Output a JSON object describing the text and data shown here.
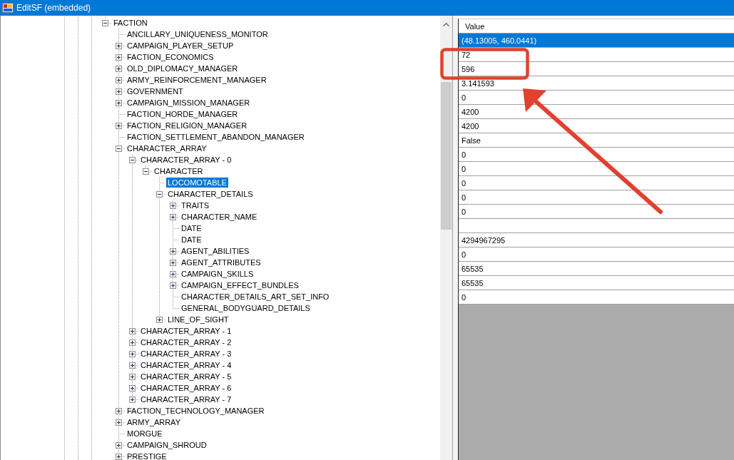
{
  "window": {
    "title": "EditSF (embedded)"
  },
  "tree": {
    "nodes": [
      {
        "label": "FACTION",
        "expanded": true,
        "selected": false,
        "children": [
          {
            "label": "ANCILLARY_UNIQUENESS_MONITOR",
            "selected": false
          },
          {
            "label": "CAMPAIGN_PLAYER_SETUP",
            "expanded": false,
            "selected": false
          },
          {
            "label": "FACTION_ECONOMICS",
            "expanded": false,
            "selected": false
          },
          {
            "label": "OLD_DIPLOMACY_MANAGER",
            "expanded": false,
            "selected": false
          },
          {
            "label": "ARMY_REINFORCEMENT_MANAGER",
            "expanded": false,
            "selected": false
          },
          {
            "label": "GOVERNMENT",
            "expanded": false,
            "selected": false
          },
          {
            "label": "CAMPAIGN_MISSION_MANAGER",
            "expanded": false,
            "selected": false
          },
          {
            "label": "FACTION_HORDE_MANAGER",
            "selected": false
          },
          {
            "label": "FACTION_RELIGION_MANAGER",
            "expanded": false,
            "selected": false
          },
          {
            "label": "FACTION_SETTLEMENT_ABANDON_MANAGER",
            "selected": false
          },
          {
            "label": "CHARACTER_ARRAY",
            "expanded": true,
            "selected": false,
            "children": [
              {
                "label": "CHARACTER_ARRAY - 0",
                "expanded": true,
                "selected": false,
                "children": [
                  {
                    "label": "CHARACTER",
                    "expanded": true,
                    "selected": false,
                    "children": [
                      {
                        "label": "LOCOMOTABLE",
                        "selected": true
                      },
                      {
                        "label": "CHARACTER_DETAILS",
                        "expanded": true,
                        "selected": false,
                        "children": [
                          {
                            "label": "TRAITS",
                            "expanded": false,
                            "selected": false
                          },
                          {
                            "label": "CHARACTER_NAME",
                            "expanded": false,
                            "selected": false
                          },
                          {
                            "label": "DATE",
                            "selected": false
                          },
                          {
                            "label": "DATE",
                            "selected": false
                          },
                          {
                            "label": "AGENT_ABILITIES",
                            "expanded": false,
                            "selected": false
                          },
                          {
                            "label": "AGENT_ATTRIBUTES",
                            "expanded": false,
                            "selected": false
                          },
                          {
                            "label": "CAMPAIGN_SKILLS",
                            "expanded": false,
                            "selected": false
                          },
                          {
                            "label": "CAMPAIGN_EFFECT_BUNDLES",
                            "expanded": false,
                            "selected": false
                          },
                          {
                            "label": "CHARACTER_DETAILS_ART_SET_INFO",
                            "selected": false
                          },
                          {
                            "label": "GENERAL_BODYGUARD_DETAILS",
                            "selected": false
                          }
                        ]
                      },
                      {
                        "label": "LINE_OF_SIGHT",
                        "expanded": false,
                        "selected": false
                      }
                    ]
                  }
                ]
              },
              {
                "label": "CHARACTER_ARRAY - 1",
                "expanded": false,
                "selected": false
              },
              {
                "label": "CHARACTER_ARRAY - 2",
                "expanded": false,
                "selected": false
              },
              {
                "label": "CHARACTER_ARRAY - 3",
                "expanded": false,
                "selected": false
              },
              {
                "label": "CHARACTER_ARRAY - 4",
                "expanded": false,
                "selected": false
              },
              {
                "label": "CHARACTER_ARRAY - 5",
                "expanded": false,
                "selected": false
              },
              {
                "label": "CHARACTER_ARRAY - 6",
                "expanded": false,
                "selected": false
              },
              {
                "label": "CHARACTER_ARRAY - 7",
                "expanded": false,
                "selected": false
              }
            ]
          },
          {
            "label": "FACTION_TECHNOLOGY_MANAGER",
            "expanded": false,
            "selected": false
          },
          {
            "label": "ARMY_ARRAY",
            "expanded": false,
            "selected": false
          },
          {
            "label": "MORGUE",
            "selected": false
          },
          {
            "label": "CAMPAIGN_SHROUD",
            "expanded": false,
            "selected": false
          },
          {
            "label": "PRESTIGE",
            "expanded": false,
            "selected": false
          }
        ]
      }
    ]
  },
  "grid": {
    "columns": [
      "Value"
    ],
    "rows": [
      {
        "value": "(48.13005, 460.0441)",
        "selected": true
      },
      {
        "value": "72",
        "selected": false
      },
      {
        "value": "596",
        "selected": false
      },
      {
        "value": "3.141593",
        "selected": false
      },
      {
        "value": "0",
        "selected": false
      },
      {
        "value": "4200",
        "selected": false
      },
      {
        "value": "4200",
        "selected": false
      },
      {
        "value": "False",
        "selected": false
      },
      {
        "value": "0",
        "selected": false
      },
      {
        "value": "0",
        "selected": false
      },
      {
        "value": "0",
        "selected": false
      },
      {
        "value": "0",
        "selected": false
      },
      {
        "value": "0",
        "selected": false
      },
      {
        "selected": false
      },
      {
        "value": "4294967295",
        "selected": false
      },
      {
        "value": "0",
        "selected": false
      },
      {
        "value": "65535",
        "selected": false
      },
      {
        "value": "65535",
        "selected": false
      },
      {
        "value": "0",
        "selected": false
      }
    ]
  }
}
